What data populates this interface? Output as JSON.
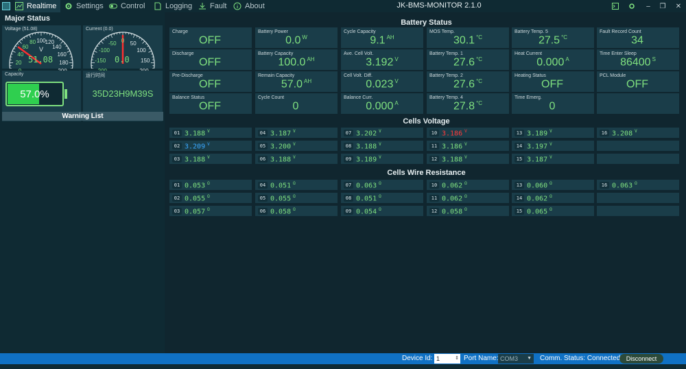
{
  "app": {
    "title": "JK-BMS-MONITOR 2.1.0"
  },
  "tabs": [
    {
      "label": "Realtime",
      "icon": "chart-icon"
    },
    {
      "label": "Settings",
      "icon": "gear-icon"
    },
    {
      "label": "Control",
      "icon": "toggle-icon"
    },
    {
      "label": "Logging",
      "icon": "document-icon"
    },
    {
      "label": "Fault",
      "icon": "download-icon"
    },
    {
      "label": "About",
      "icon": "info-icon"
    }
  ],
  "left": {
    "title": "Major Status",
    "voltage": {
      "label": "Voltage (51.08)",
      "unit": "V",
      "readout": "51.08",
      "value": 51.08,
      "ticks": [
        "0",
        "20",
        "40",
        "60",
        "80",
        "100",
        "120",
        "140",
        "160",
        "180",
        "200"
      ]
    },
    "current": {
      "label": "Current (0.0)",
      "readout": "0.0",
      "value": 0.0,
      "ticks": [
        "-200",
        "-150",
        "-100",
        "-50",
        "0",
        "50",
        "100",
        "150",
        "200"
      ]
    },
    "capacity": {
      "label": "Capacity",
      "value": "57.0%",
      "fraction": 0.57
    },
    "runtime": {
      "label": "运行时间",
      "value": "35D23H9M39S"
    },
    "warning_title": "Warning List"
  },
  "battery_status": {
    "title": "Battery Status",
    "cells": [
      {
        "label": "Charge",
        "value": "OFF",
        "unit": ""
      },
      {
        "label": "Battery Power",
        "value": "0.0",
        "unit": "W"
      },
      {
        "label": "Cycle Capacity",
        "value": "9.1",
        "unit": "AH"
      },
      {
        "label": "MOS Temp.",
        "value": "30.1",
        "unit": "°C"
      },
      {
        "label": "Battery Temp. 5",
        "value": "27.5",
        "unit": "°C"
      },
      {
        "label": "Fault Record Count",
        "value": "34",
        "unit": ""
      },
      {
        "label": "Discharge",
        "value": "OFF",
        "unit": ""
      },
      {
        "label": "Battery Capacity",
        "value": "100.0",
        "unit": "AH"
      },
      {
        "label": "Ave. Cell Volt.",
        "value": "3.192",
        "unit": "V"
      },
      {
        "label": "Battery Temp. 1",
        "value": "27.6",
        "unit": "°C"
      },
      {
        "label": "Heat Current",
        "value": "0.000",
        "unit": "A"
      },
      {
        "label": "Time Enter Sleep",
        "value": "86400",
        "unit": "S"
      },
      {
        "label": "Pre-Discharge",
        "value": "OFF",
        "unit": ""
      },
      {
        "label": "Remain Capacity",
        "value": "57.0",
        "unit": "AH"
      },
      {
        "label": "Cell Volt. Diff.",
        "value": "0.023",
        "unit": "V"
      },
      {
        "label": "Battery Temp. 2",
        "value": "27.6",
        "unit": "°C"
      },
      {
        "label": "Heating Status",
        "value": "OFF",
        "unit": ""
      },
      {
        "label": "PCL Module",
        "value": "OFF",
        "unit": ""
      },
      {
        "label": "Balance Status",
        "value": "OFF",
        "unit": ""
      },
      {
        "label": "Cycle Count",
        "value": "0",
        "unit": ""
      },
      {
        "label": "Balance Curr.",
        "value": "0.000",
        "unit": "A"
      },
      {
        "label": "Battery Temp. 4",
        "value": "27.8",
        "unit": "°C"
      },
      {
        "label": "Time Emerg.",
        "value": "0",
        "unit": ""
      }
    ]
  },
  "cells_voltage": {
    "title": "Cells Voltage",
    "unit": "V",
    "items": [
      {
        "idx": "01",
        "value": "3.188",
        "color": "#7fe07f"
      },
      {
        "idx": "02",
        "value": "3.209",
        "color": "#3aa8ff"
      },
      {
        "idx": "03",
        "value": "3.188",
        "color": "#7fe07f"
      },
      {
        "idx": "04",
        "value": "3.187",
        "color": "#7fe07f"
      },
      {
        "idx": "05",
        "value": "3.200",
        "color": "#7fe07f"
      },
      {
        "idx": "06",
        "value": "3.188",
        "color": "#7fe07f"
      },
      {
        "idx": "07",
        "value": "3.202",
        "color": "#7fe07f"
      },
      {
        "idx": "08",
        "value": "3.188",
        "color": "#7fe07f"
      },
      {
        "idx": "09",
        "value": "3.189",
        "color": "#7fe07f"
      },
      {
        "idx": "10",
        "value": "3.186",
        "color": "#ff3a3a"
      },
      {
        "idx": "11",
        "value": "3.186",
        "color": "#7fe07f"
      },
      {
        "idx": "12",
        "value": "3.188",
        "color": "#7fe07f"
      },
      {
        "idx": "13",
        "value": "3.189",
        "color": "#7fe07f"
      },
      {
        "idx": "14",
        "value": "3.197",
        "color": "#7fe07f"
      },
      {
        "idx": "15",
        "value": "3.187",
        "color": "#7fe07f"
      },
      {
        "idx": "16",
        "value": "3.208",
        "color": "#7fe07f"
      }
    ]
  },
  "cells_resistance": {
    "title": "Cells Wire Resistance",
    "unit": "Ω",
    "items": [
      {
        "idx": "01",
        "value": "0.053"
      },
      {
        "idx": "02",
        "value": "0.055"
      },
      {
        "idx": "03",
        "value": "0.057"
      },
      {
        "idx": "04",
        "value": "0.051"
      },
      {
        "idx": "05",
        "value": "0.055"
      },
      {
        "idx": "06",
        "value": "0.058"
      },
      {
        "idx": "07",
        "value": "0.063"
      },
      {
        "idx": "08",
        "value": "0.051"
      },
      {
        "idx": "09",
        "value": "0.054"
      },
      {
        "idx": "10",
        "value": "0.062"
      },
      {
        "idx": "11",
        "value": "0.062"
      },
      {
        "idx": "12",
        "value": "0.058"
      },
      {
        "idx": "13",
        "value": "0.060"
      },
      {
        "idx": "14",
        "value": "0.062"
      },
      {
        "idx": "15",
        "value": "0.065"
      },
      {
        "idx": "16",
        "value": "0.063"
      }
    ]
  },
  "statusbar": {
    "device_id_label": "Device Id:",
    "device_id_value": "1",
    "port_label": "Port Name:",
    "port_value": "COM3",
    "comm_status": "Comm. Status: Connected",
    "disconnect_label": "Disconnect"
  },
  "colors": {
    "accent": "#7fe07f",
    "panel": "#1a3d49",
    "background": "#10262f",
    "statusbar": "#1071c4"
  }
}
